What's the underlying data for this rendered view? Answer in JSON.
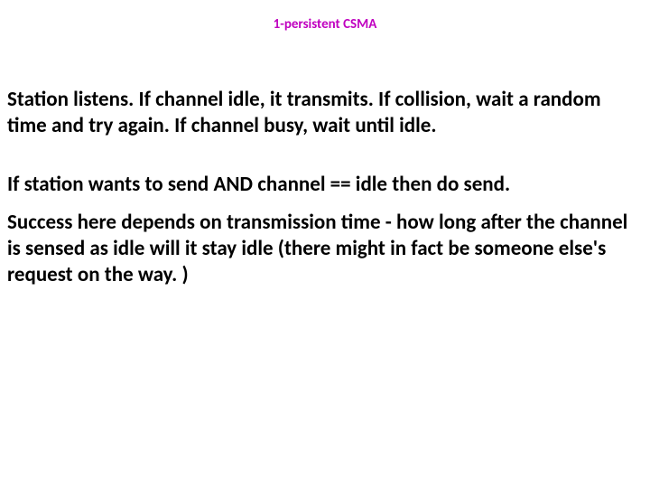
{
  "title": "1-persistent CSMA",
  "p1": "Station listens.  If channel idle, it transmits.  If collision, wait a random time and try again.  If channel busy, wait until idle.",
  "p2": "If   station wants to send   AND     channel == idle         then   do send.",
  "p3": "Success here depends on transmission time - how long after the channel is sensed as idle will it stay idle (there might in fact be someone else's request on the way. )"
}
